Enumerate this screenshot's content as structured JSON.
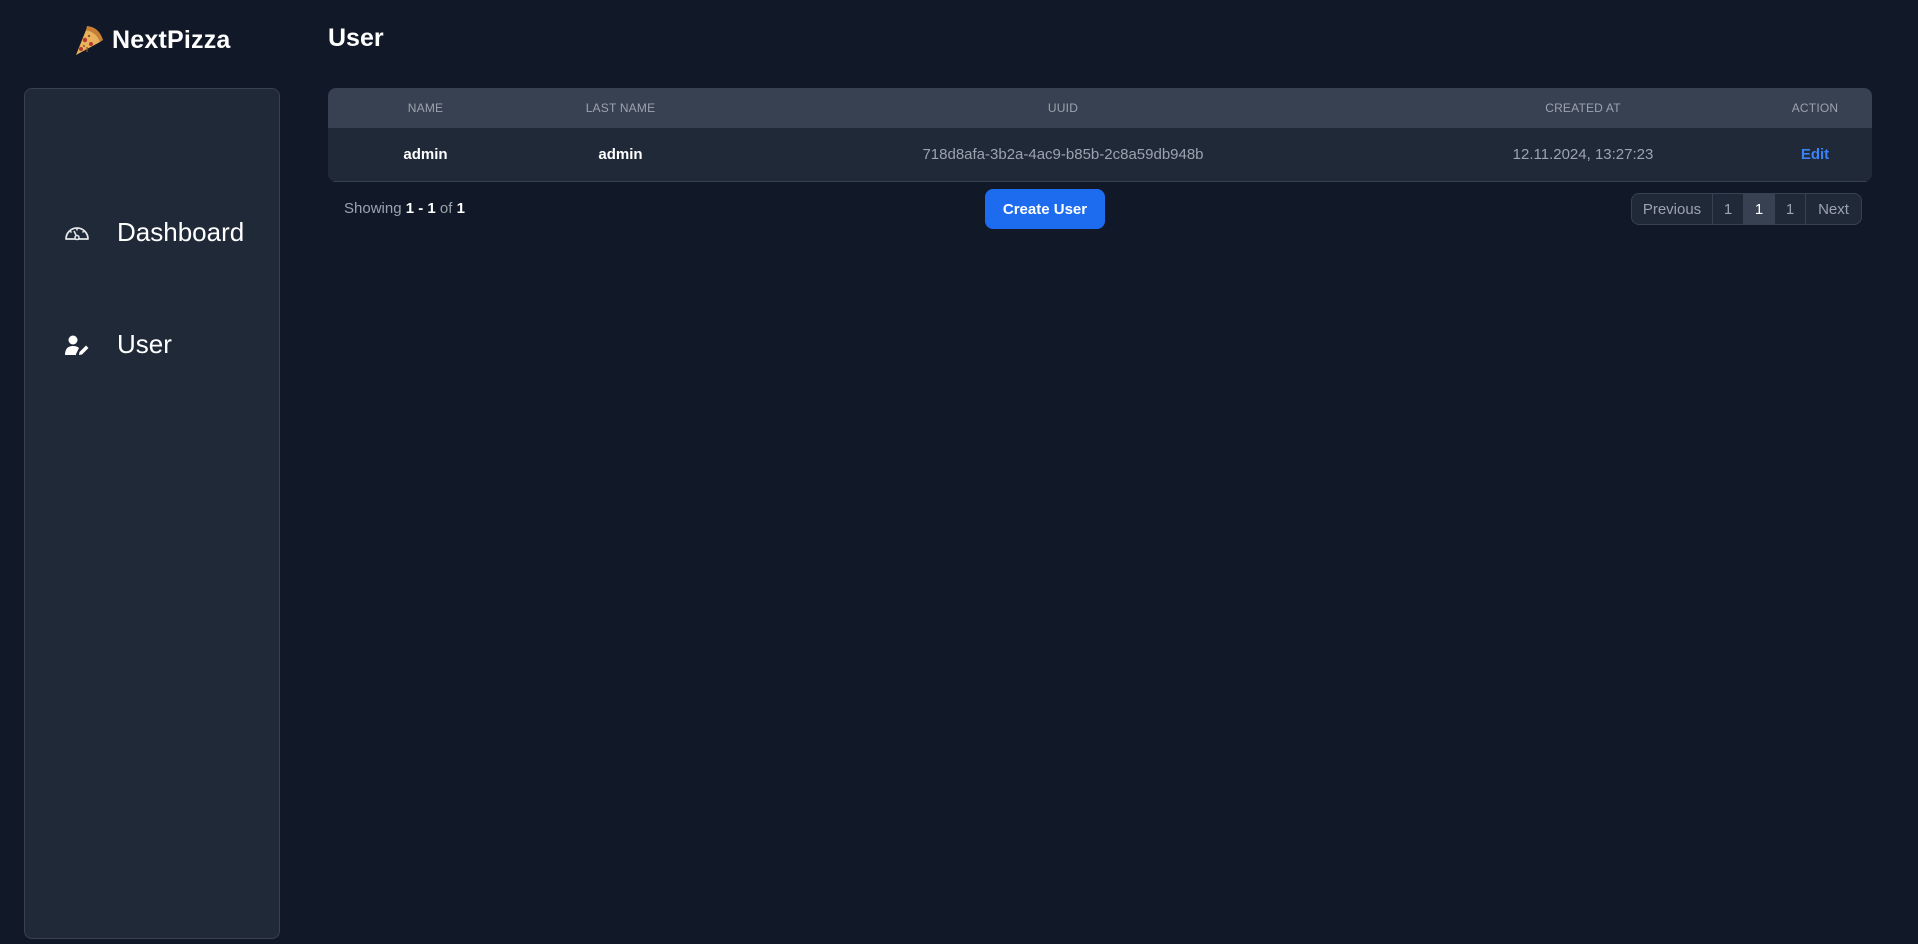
{
  "app": {
    "brand": "NextPizza",
    "logo_icon": "pizza-slice-icon"
  },
  "sidebar": {
    "items": [
      {
        "label": "Dashboard",
        "icon": "gauge-icon"
      },
      {
        "label": "User",
        "icon": "user-edit-icon"
      }
    ]
  },
  "page": {
    "title": "User"
  },
  "table": {
    "columns": [
      "NAME",
      "LAST NAME",
      "UUID",
      "CREATED AT",
      "ACTION"
    ],
    "rows": [
      {
        "name": "admin",
        "last_name": "admin",
        "uuid": "718d8afa-3b2a-4ac9-b85b-2c8a59db948b",
        "created_at": "12.11.2024, 13:27:23",
        "action": "Edit"
      }
    ]
  },
  "footer": {
    "showing_prefix": "Showing",
    "range_start": "1",
    "range_sep": " - ",
    "range_end": "1",
    "of_label": "of",
    "total": "1",
    "create_button": "Create User"
  },
  "pagination": {
    "previous": "Previous",
    "pages": [
      "1",
      "1",
      "1"
    ],
    "active_index": 1,
    "next": "Next"
  },
  "colors": {
    "background": "#111827",
    "panel": "#1f2937",
    "header": "#374151",
    "accent": "#1d6cf0",
    "link": "#3b82f6"
  }
}
